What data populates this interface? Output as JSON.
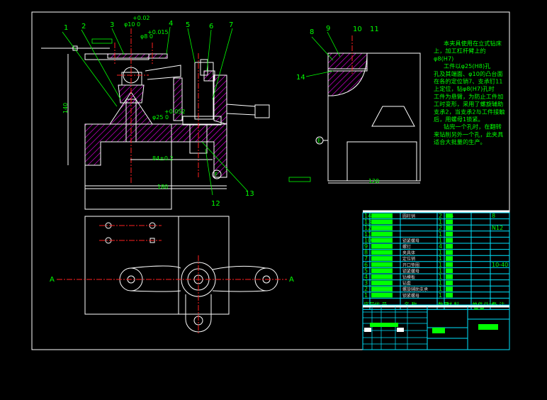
{
  "colors": {
    "background": "#000000",
    "outline": "#ffffff",
    "centerline": "#ff2020",
    "annotation": "#00ff00",
    "hatch": "#ff00ff",
    "table_grid": "#00e5ff"
  },
  "balloons": [
    "1",
    "2",
    "3",
    "4",
    "5",
    "6",
    "7",
    "8",
    "9",
    "10",
    "11",
    "12",
    "13",
    "14"
  ],
  "dimensions": {
    "d10_tol": "+0.02",
    "d10": "φ10  0",
    "d8_tol": "+0.015",
    "d8": "φ8  0",
    "d25_tol": "+0.052",
    "d25": "φ25  0",
    "d84": "84±0.2",
    "d180": "180",
    "d140": "140",
    "d120": "120"
  },
  "section_marks": {
    "left": "A",
    "right": "A"
  },
  "datum_marks": {
    "front": "F",
    "side": "E"
  },
  "notes": [
    "本夹具使用在立式钻床",
    "上，加工杠杆臂上的",
    "φ8(H7)",
    "工件以φ25(H8)孔",
    "孔及其端面、φ10的凸台面",
    "在各的定位销7、支承钉11",
    "上定位，钻φ8(H7)孔时",
    "工件为悬臂，为防止工件加",
    "工时变形，采用了螺旋辅助",
    "支承2，当支承2与工件接触",
    "后，用螺母1锁紧。",
    "钻完一个孔时，在翻转",
    "来钻削另外一个孔，此夹具",
    "适合大批量的生产。"
  ],
  "parts_list": {
    "rows": [
      {
        "no": "14",
        "name": "圆柱销",
        "qty": "2",
        "material": "35",
        "remark": "8"
      },
      {
        "no": "13",
        "name": "",
        "qty": "1",
        "material": "",
        "remark": ""
      },
      {
        "no": "12",
        "name": "",
        "qty": "2",
        "material": "",
        "remark": "N12"
      },
      {
        "no": "11",
        "name": "",
        "qty": "1",
        "material": "",
        "remark": ""
      },
      {
        "no": "10",
        "name": "锁紧螺母",
        "qty": "1",
        "material": "",
        "remark": ""
      },
      {
        "no": "9",
        "name": "螺钉",
        "qty": "4",
        "material": "",
        "remark": ""
      },
      {
        "no": "8",
        "name": "夹具体",
        "qty": "1",
        "material": "",
        "remark": ""
      },
      {
        "no": "7",
        "name": "定位销",
        "qty": "1",
        "material": "",
        "remark": ""
      },
      {
        "no": "6",
        "name": "开口垫圈",
        "qty": "1",
        "material": "",
        "remark": "10-40"
      },
      {
        "no": "5",
        "name": "锁紧螺母",
        "qty": "1",
        "material": "",
        "remark": ""
      },
      {
        "no": "4",
        "name": "钻模板",
        "qty": "1",
        "material": "",
        "remark": ""
      },
      {
        "no": "3",
        "name": "钻套",
        "qty": "1",
        "material": "",
        "remark": ""
      },
      {
        "no": "2",
        "name": "螺旋辅助支承",
        "qty": "1",
        "material": "",
        "remark": ""
      },
      {
        "no": "1",
        "name": "锁紧螺母",
        "qty": "1",
        "material": "",
        "remark": ""
      }
    ],
    "header": {
      "no": "序号",
      "code": "代  号",
      "name": "名    称",
      "qty": "数量",
      "material": "材    料",
      "weight": "单件总计",
      "weight2": "重量",
      "remark": "备 注"
    }
  }
}
